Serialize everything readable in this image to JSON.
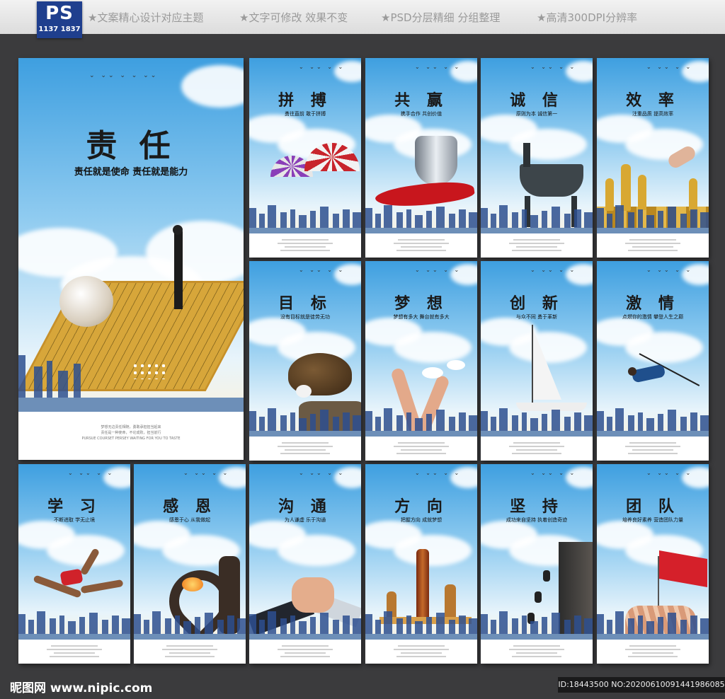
{
  "header": {
    "badge_ps": "PS",
    "badge_number": "1137 1837",
    "features": [
      "★文案精心设计对应主题",
      "★文字可修改 效果不变",
      "★PSD分层精细 分组整理",
      "★高清300DPI分辨率"
    ]
  },
  "main_poster": {
    "title": "责 任",
    "tagline": "责任就是使命  责任就是能力",
    "body_lines": [
      "梦想无边责任相随，勇敢承担担当起来",
      "责任是一种使命，不论成败，担当前行",
      "PURSUE COURSET PERSEY WAITING FOR YOU TO TASTE"
    ]
  },
  "posters": [
    {
      "title": "拼 搏",
      "sub": "勇往直前  敢于拼搏",
      "scene": "parachutes"
    },
    {
      "title": "共 赢",
      "sub": "携手合作  共创价值",
      "scene": "trophy"
    },
    {
      "title": "诚 信",
      "sub": "原则为本    诚信第一",
      "scene": "cauldron"
    },
    {
      "title": "效 率",
      "sub": "注重品质    提高效率",
      "scene": "chess-gold"
    },
    {
      "title": "目 标",
      "sub": "没有目标就是徒劳无功",
      "scene": "eagle"
    },
    {
      "title": "梦 想",
      "sub": "梦想有多大    舞台就有多大",
      "scene": "hands-dove"
    },
    {
      "title": "创 新",
      "sub": "与众不同  勇于革新",
      "scene": "sailboat"
    },
    {
      "title": "激 情",
      "sub": "点燃你的激情  攀登人生之巅",
      "scene": "pole-vault"
    },
    {
      "title": "学 习",
      "sub": "不断进取    学无止境",
      "scene": "runner"
    },
    {
      "title": "感 恩",
      "sub": "感恩于心  从我做起",
      "scene": "heart-hands"
    },
    {
      "title": "沟 通",
      "sub": "为人谦虚  乐于沟通",
      "scene": "handshake"
    },
    {
      "title": "方 向",
      "sub": "把握方向    成就梦想",
      "scene": "chess-bronze"
    },
    {
      "title": "坚 持",
      "sub": "成功来自坚持  执着创造奇迹",
      "scene": "climbers"
    },
    {
      "title": "团 队",
      "sub": "培养良好素养  营造团队力量",
      "scene": "flag-hands"
    }
  ],
  "footer": {
    "watermark": "昵图网 www.nipic.com",
    "id_text": "ID:18443500 NO:20200610091441986085"
  }
}
